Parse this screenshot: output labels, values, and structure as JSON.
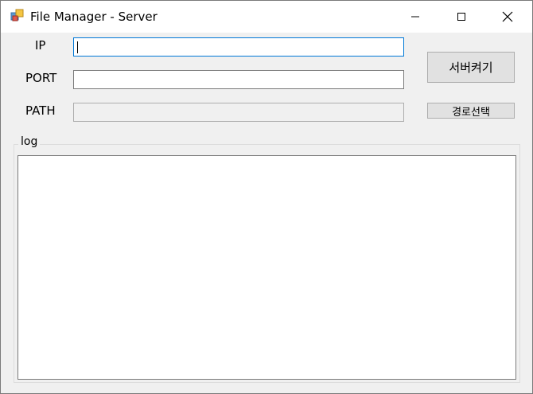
{
  "window": {
    "title": "File Manager - Server"
  },
  "form": {
    "ip": {
      "label": "IP",
      "value": ""
    },
    "port": {
      "label": "PORT",
      "value": ""
    },
    "path": {
      "label": "PATH",
      "value": ""
    }
  },
  "buttons": {
    "start_server": "서버켜기",
    "select_path": "경로선택"
  },
  "log": {
    "title": "log",
    "content": ""
  },
  "colors": {
    "focus_border": "#0078d7",
    "window_bg": "#f0f0f0",
    "titlebar_bg": "#ffffff"
  }
}
